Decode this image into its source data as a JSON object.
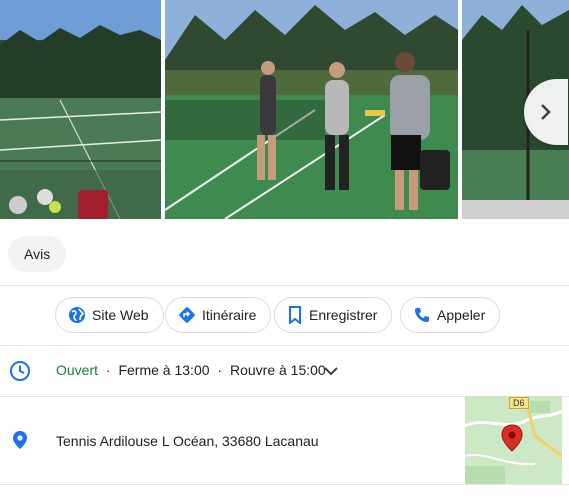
{
  "photos": [
    {
      "subject": "tennis court with equipment"
    },
    {
      "subject": "group of tennis players on court"
    },
    {
      "subject": "tennis court with fence"
    }
  ],
  "photo_nav": {
    "icon": "chevron-right-icon"
  },
  "reviews_chip": {
    "label": "Avis"
  },
  "actions": [
    {
      "label": "Site Web",
      "icon": "globe-icon"
    },
    {
      "label": "Itinéraire",
      "icon": "directions-icon"
    },
    {
      "label": "Enregistrer",
      "icon": "bookmark-icon"
    },
    {
      "label": "Appeler",
      "icon": "phone-icon"
    }
  ],
  "hours": {
    "status": "Ouvert",
    "separator": "·",
    "closes": "Ferme à 13:00",
    "reopens": "Rouvre à 15:00"
  },
  "address": {
    "text": "Tennis Ardilouse L Océan, 33680 Lacanau",
    "map_road_label": "D6"
  },
  "colors": {
    "accent_blue": "#1a73e8",
    "open_green": "#188038",
    "map_pin_red": "#d93025"
  }
}
